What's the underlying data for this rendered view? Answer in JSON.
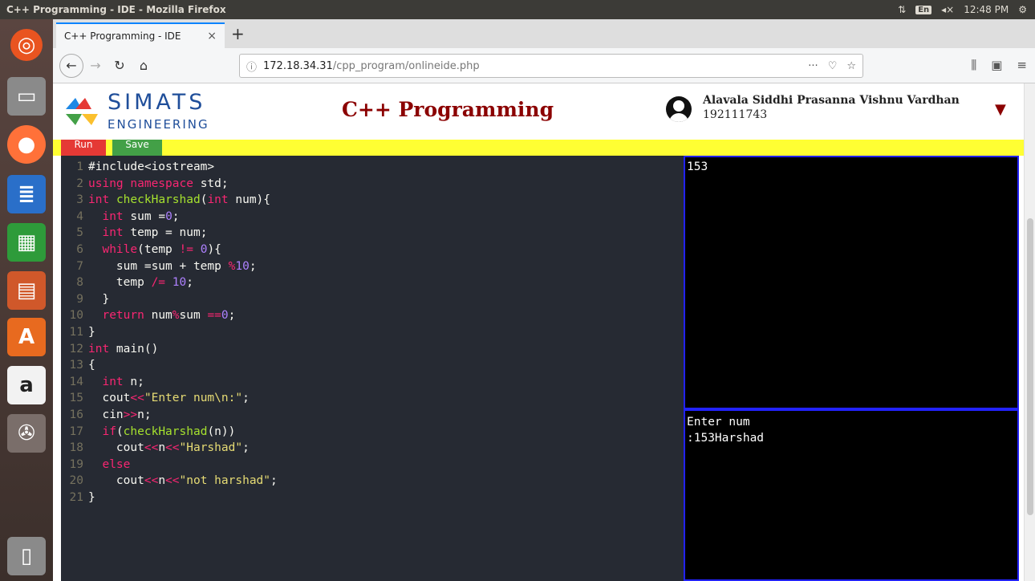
{
  "system": {
    "window_title": "C++ Programming - IDE - Mozilla Firefox",
    "keyboard_lang": "En",
    "time": "12:48 PM"
  },
  "browser": {
    "tab_title": "C++ Programming - IDE",
    "tab_close": "×",
    "new_tab": "+",
    "url_host": "172.18.34.31",
    "url_path": "/cpp_program/onlineide.php",
    "url_more": "···"
  },
  "header": {
    "brand_top": "SIMATS",
    "brand_bottom": "ENGINEERING",
    "title": "C++ Programming",
    "user_name": "Alavala Siddhi Prasanna Vishnu Vardhan",
    "user_id": "192111743",
    "menu_glyph": "▼"
  },
  "toolbar": {
    "run_label": "Run",
    "save_label": "Save"
  },
  "editor": {
    "lines": [
      "#include<iostream>",
      "using namespace std;",
      "int checkHarshad(int num){",
      "  int sum =0;",
      "  int temp = num;",
      "  while(temp != 0){",
      "    sum =sum + temp %10;",
      "    temp /= 10;",
      "  }",
      "  return num%sum ==0;",
      "}",
      "int main()",
      "{",
      "  int n;",
      "  cout<<\"Enter num\\n:\";",
      "  cin>>n;",
      "  if(checkHarshad(n))",
      "    cout<<n<<\"Harshad\";",
      "  else",
      "    cout<<n<<\"not harshad\";",
      "}"
    ]
  },
  "input_pane": {
    "text": "153"
  },
  "output_pane": {
    "text": "Enter num\n:153Harshad"
  },
  "colors": {
    "title_color": "#8b0000",
    "toolbar_yellow": "#ffff33",
    "run_red": "#e53935",
    "save_green": "#43a047",
    "pane_border": "#2222ff"
  }
}
